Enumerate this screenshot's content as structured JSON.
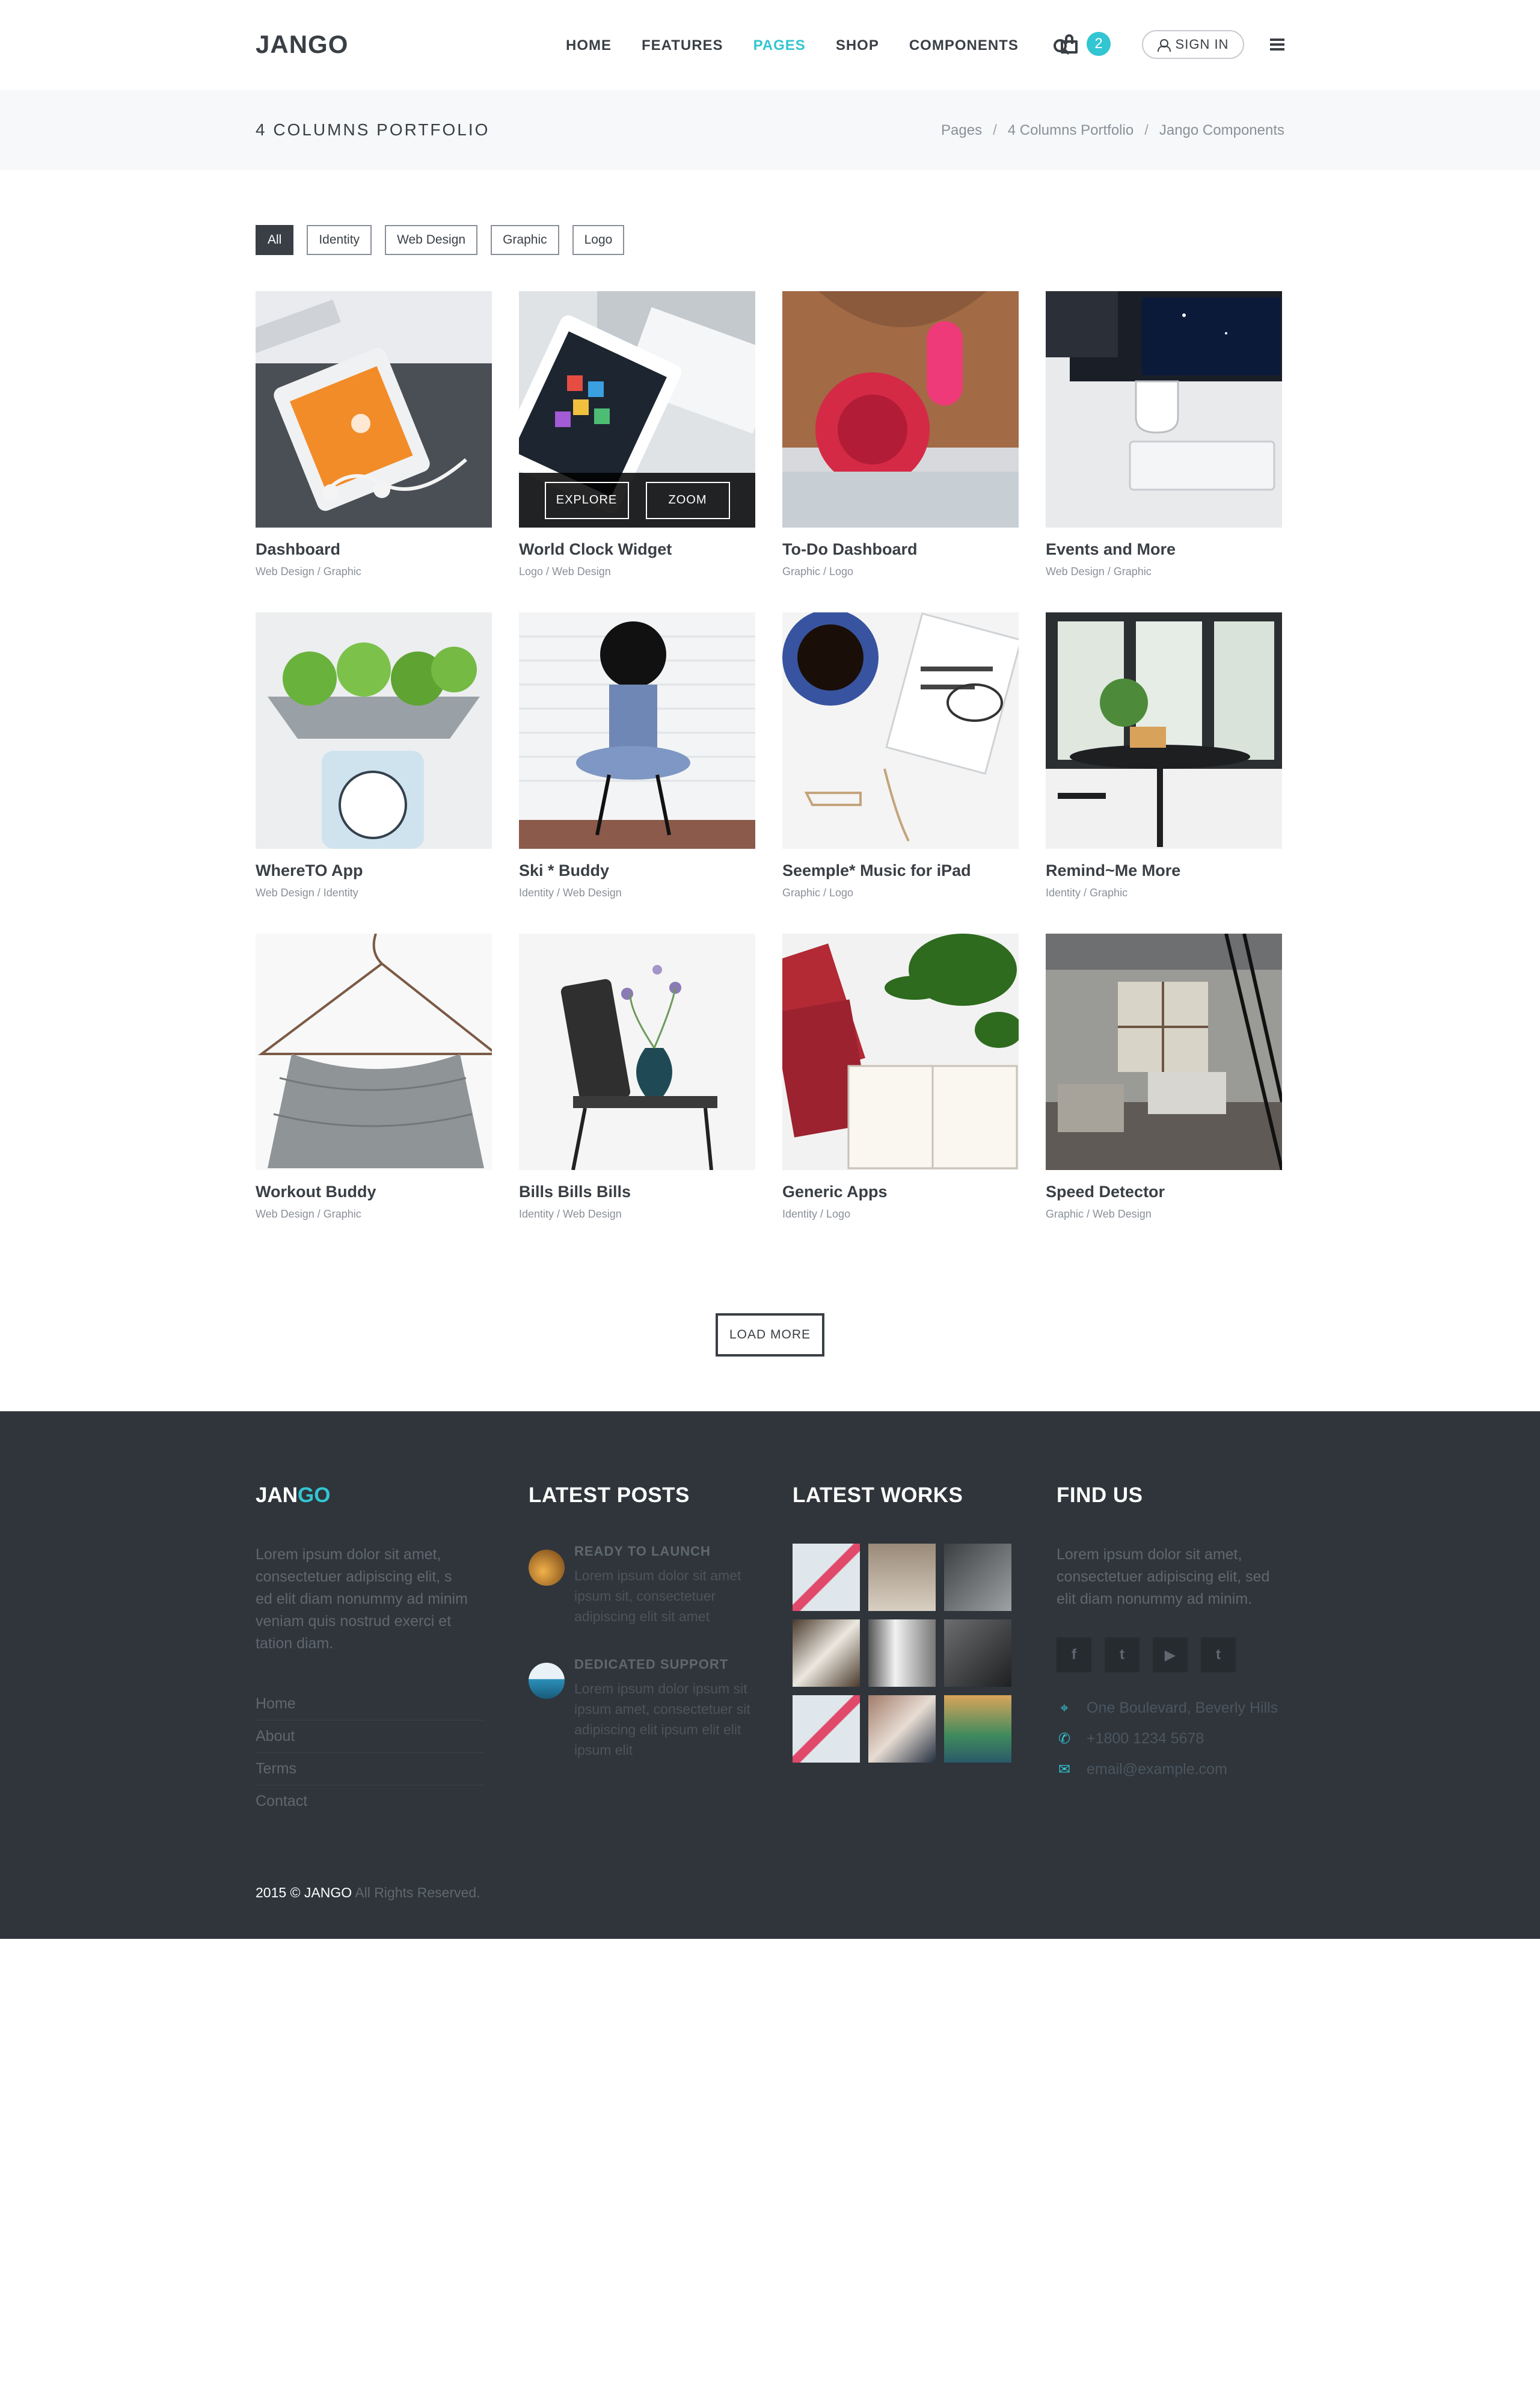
{
  "header": {
    "logo": "JANGO",
    "nav": [
      {
        "label": "HOME",
        "active": false
      },
      {
        "label": "FEATURES",
        "active": false
      },
      {
        "label": "PAGES",
        "active": true
      },
      {
        "label": "SHOP",
        "active": false
      },
      {
        "label": "COMPONENTS",
        "active": false
      }
    ],
    "cart_count": "2",
    "signin_label": "SIGN IN"
  },
  "titlebar": {
    "title": "4 COLUMNS PORTFOLIO",
    "breadcrumb": [
      "Pages",
      "4 Columns Portfolio",
      "Jango Components"
    ]
  },
  "filters": [
    {
      "label": "All",
      "active": true
    },
    {
      "label": "Identity",
      "active": false
    },
    {
      "label": "Web Design",
      "active": false
    },
    {
      "label": "Graphic",
      "active": false
    },
    {
      "label": "Logo",
      "active": false
    }
  ],
  "portfolio": [
    {
      "title": "Dashboard",
      "categories": "Web Design / Graphic"
    },
    {
      "title": "World Clock Widget",
      "categories": "Logo / Web Design",
      "overlay": {
        "explore": "EXPLORE",
        "zoom": "ZOOM"
      }
    },
    {
      "title": "To-Do Dashboard",
      "categories": "Graphic / Logo"
    },
    {
      "title": "Events and More",
      "categories": "Web Design / Graphic"
    },
    {
      "title": "WhereTO App",
      "categories": "Web Design / Identity"
    },
    {
      "title": "Ski * Buddy",
      "categories": "Identity / Web Design"
    },
    {
      "title": "Seemple* Music for iPad",
      "categories": "Graphic / Logo"
    },
    {
      "title": "Remind~Me More",
      "categories": "Identity / Graphic"
    },
    {
      "title": "Workout Buddy",
      "categories": "Web Design / Graphic"
    },
    {
      "title": "Bills Bills Bills",
      "categories": "Identity / Web Design"
    },
    {
      "title": "Generic Apps",
      "categories": "Identity / Logo"
    },
    {
      "title": "Speed Detector",
      "categories": "Graphic / Web Design"
    }
  ],
  "load_more": "LOAD MORE",
  "footer": {
    "logo_a": "JAN",
    "logo_b": "GO",
    "about": "Lorem ipsum dolor sit amet, consectetuer adipiscing elit, s ed elit diam nonummy ad minim veniam quis nostrud exerci et tation diam.",
    "links": [
      "Home",
      "About",
      "Terms",
      "Contact"
    ],
    "posts_heading": "LATEST POSTS",
    "posts": [
      {
        "title": "READY TO LAUNCH",
        "text": "Lorem ipsum dolor sit amet ipsum sit, consectetuer adipiscing elit sit amet"
      },
      {
        "title": "DEDICATED SUPPORT",
        "text": "Lorem ipsum dolor ipsum sit ipsum amet, consectetuer sit adipiscing elit ipsum elit elit ipsum elit"
      }
    ],
    "works_heading": "LATEST WORKS",
    "find_heading": "FIND US",
    "find_text": "Lorem ipsum dolor sit amet, consectetuer adipiscing elit, sed elit diam nonummy ad minim.",
    "social": [
      "f",
      "t",
      "▶",
      "t"
    ],
    "address": "One Boulevard, Beverly Hills",
    "phone": "+1800 1234 5678",
    "email": "email@example.com",
    "copyright_a": "2015 © JANGO",
    "copyright_b": "All Rights Reserved."
  },
  "colors": {
    "accent": "#32c5d2",
    "dark": "#3a3f45",
    "footer_bg": "#2f353b"
  }
}
